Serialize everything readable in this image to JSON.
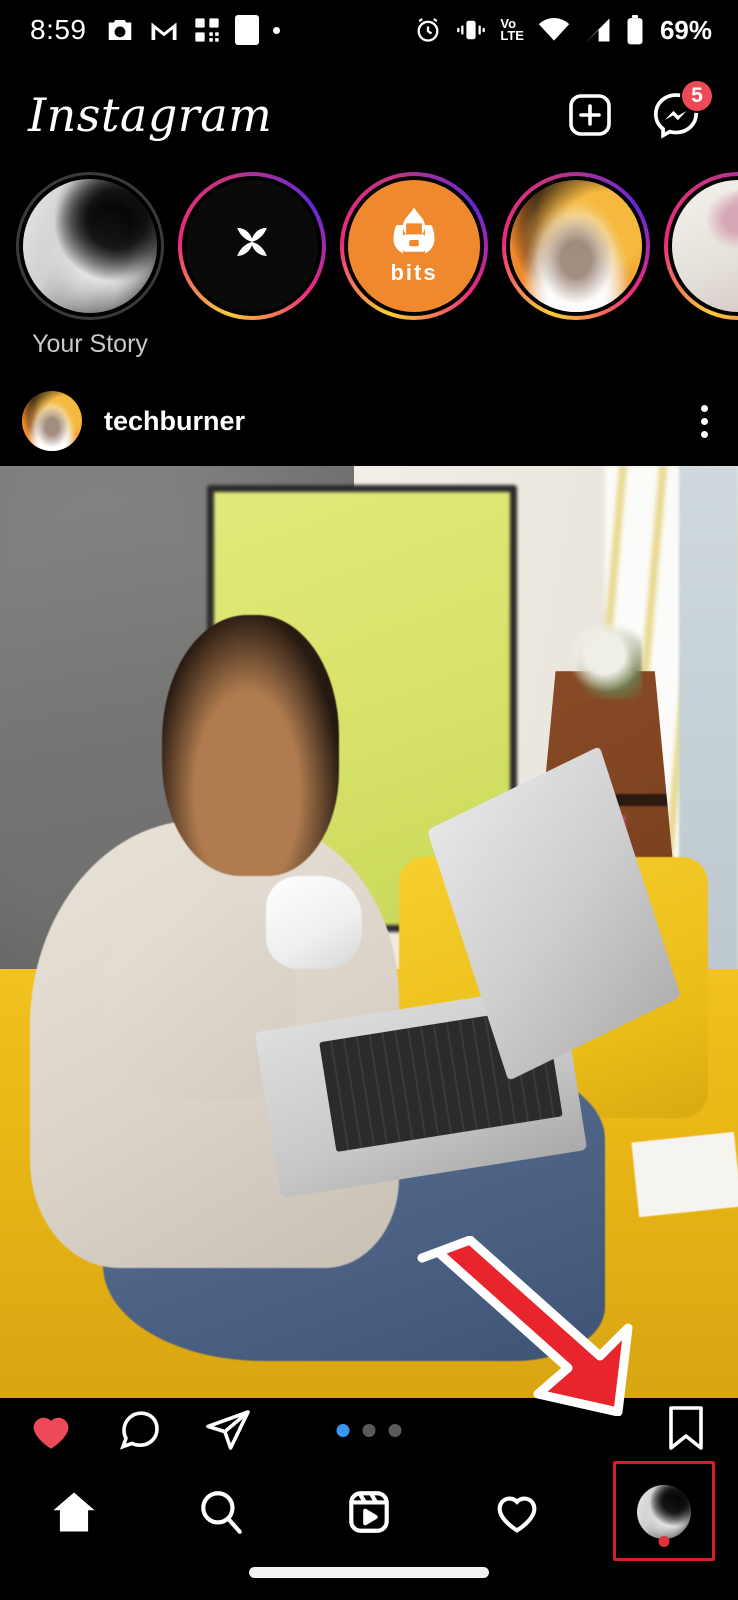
{
  "status_bar": {
    "time": "8:59",
    "battery_percent": "69%",
    "network_label": "Vo\nLTE",
    "left_icons": [
      "camera-icon",
      "gmail-icon",
      "qr-scanner-icon",
      "white-square-icon",
      "small-dot-icon"
    ],
    "right_icons": [
      "alarm-icon",
      "vibrate-icon",
      "volte-icon",
      "wifi-icon",
      "signal-icon",
      "battery-icon"
    ]
  },
  "header": {
    "app_title": "Instagram",
    "add_post_label": "+",
    "messenger_badge": "5"
  },
  "stories": {
    "items": [
      {
        "label": "Your Story",
        "avatar": "gray-portrait",
        "ring": "none"
      },
      {
        "label": "",
        "avatar": "black-logo",
        "ring": "gradient"
      },
      {
        "label": "",
        "avatar": "bits-flame",
        "ring": "gradient",
        "badge_text": "bits"
      },
      {
        "label": "",
        "avatar": "orange-face",
        "ring": "gradient"
      },
      {
        "label": "",
        "avatar": "flowers",
        "ring": "gradient"
      }
    ]
  },
  "post": {
    "username": "techburner",
    "avatar": "orange-face",
    "more_label": "⋮",
    "liked": true,
    "carousel": {
      "total": 3,
      "active_index": 0
    },
    "actions": {
      "like": "like-button",
      "comment": "comment-button",
      "share": "share-button",
      "save": "save-button"
    }
  },
  "annotations": {
    "arrow": "red-down-right-arrow",
    "highlight_box": "red-rectangle-around-profile-tab"
  },
  "bottom_nav": {
    "items": [
      {
        "name": "home",
        "icon": "home-icon",
        "active": true
      },
      {
        "name": "search",
        "icon": "search-icon",
        "active": false
      },
      {
        "name": "reels",
        "icon": "reels-icon",
        "active": false
      },
      {
        "name": "activity",
        "icon": "heart-icon",
        "active": false
      },
      {
        "name": "profile",
        "icon": "profile-avatar",
        "active": false,
        "has_dot": true
      }
    ]
  },
  "colors": {
    "background": "#000000",
    "accent_blue": "#3897f0",
    "badge_red": "#ed4956",
    "annotation_red": "#e8252c",
    "story_orange": "#f0882e"
  }
}
